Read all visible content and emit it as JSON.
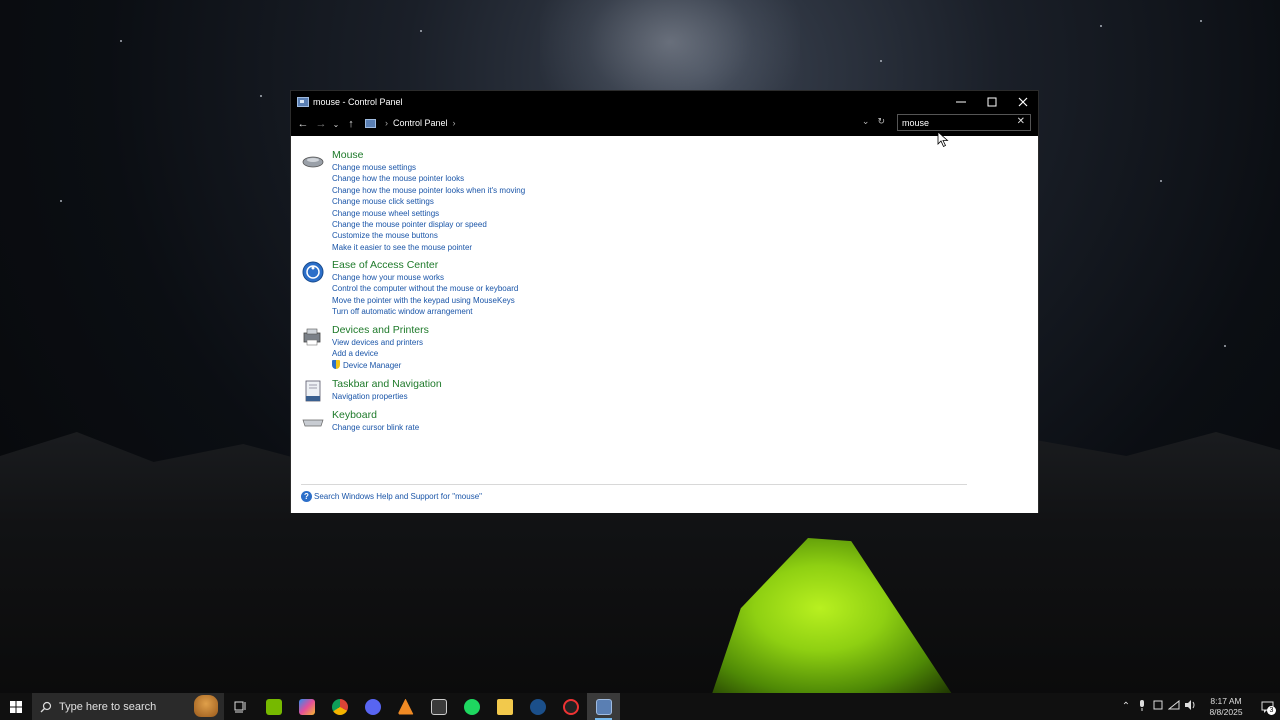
{
  "window": {
    "title": "mouse - Control Panel",
    "breadcrumb": [
      "Control Panel"
    ],
    "search_value": "mouse"
  },
  "groups": [
    {
      "title": "Mouse",
      "icon": "mouse-icon",
      "links": [
        "Change mouse settings",
        "Change how the mouse pointer looks",
        "Change how the mouse pointer looks when it's moving",
        "Change mouse click settings",
        "Change mouse wheel settings",
        "Change the mouse pointer display or speed",
        "Customize the mouse buttons",
        "Make it easier to see the mouse pointer"
      ]
    },
    {
      "title": "Ease of Access Center",
      "icon": "ease-of-access-icon",
      "links": [
        "Change how your mouse works",
        "Control the computer without the mouse or keyboard",
        "Move the pointer with the keypad using MouseKeys",
        "Turn off automatic window arrangement"
      ]
    },
    {
      "title": "Devices and Printers",
      "icon": "devices-printers-icon",
      "links": [
        "View devices and printers",
        "Add a device",
        "Device Manager"
      ]
    },
    {
      "title": "Taskbar and Navigation",
      "icon": "taskbar-navigation-icon",
      "links": [
        "Navigation properties"
      ]
    },
    {
      "title": "Keyboard",
      "icon": "keyboard-icon",
      "links": [
        "Change cursor blink rate"
      ]
    }
  ],
  "help_link": "Search Windows Help and Support for \"mouse\"",
  "taskbar": {
    "search_placeholder": "Type here to search",
    "apps": [
      "task-view",
      "nvidia",
      "copilot",
      "chrome",
      "discord",
      "vlc",
      "microsoft-store",
      "spotify",
      "file-explorer",
      "steam",
      "capture-app",
      "control-panel"
    ],
    "time": "8:17 AM",
    "date": "8/8/2025",
    "notification_count": "3"
  },
  "colors": {
    "link": "#1a55a8",
    "group_title": "#1e7a2a",
    "titlebar": "#000000",
    "taskbar": "#101010"
  }
}
